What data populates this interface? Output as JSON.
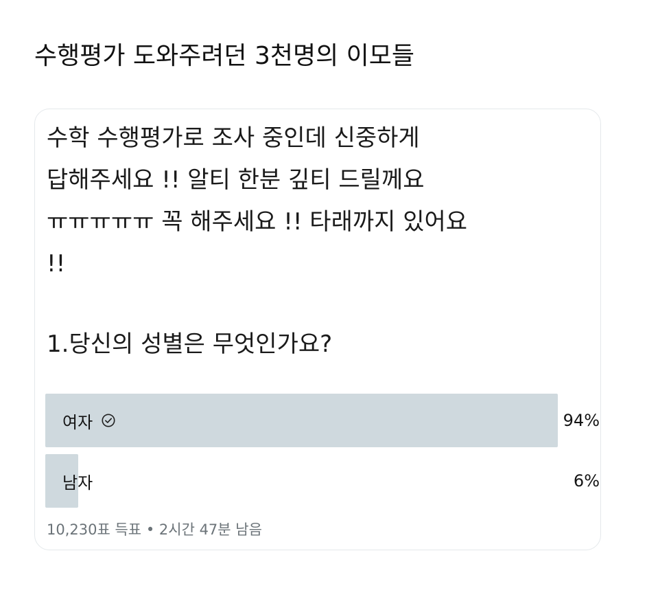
{
  "title": "수행평가 도와주려던 3천명의 이모들",
  "tweet": {
    "lines": [
      "수학 수행평가로 조사 중인데 신중하게",
      "답해주세요 !! 알티 한분 깊티 드릴께요",
      "ㅠㅠㅠㅠㅠ 꼭 해주세요 !! 타래까지 있어요",
      "!!"
    ],
    "question": "1.당신의 성별은 무엇인가요?"
  },
  "poll": {
    "options": [
      {
        "label": "여자",
        "percent": 94,
        "percent_text": "94%",
        "selected": true,
        "selected_icon": "check-circle-icon"
      },
      {
        "label": "남자",
        "percent": 6,
        "percent_text": "6%",
        "selected": false
      }
    ],
    "votes_text": "10,230표 득표",
    "separator": "•",
    "time_left_text": "2시간 47분 남음",
    "bar_color": "#cfd9de"
  }
}
